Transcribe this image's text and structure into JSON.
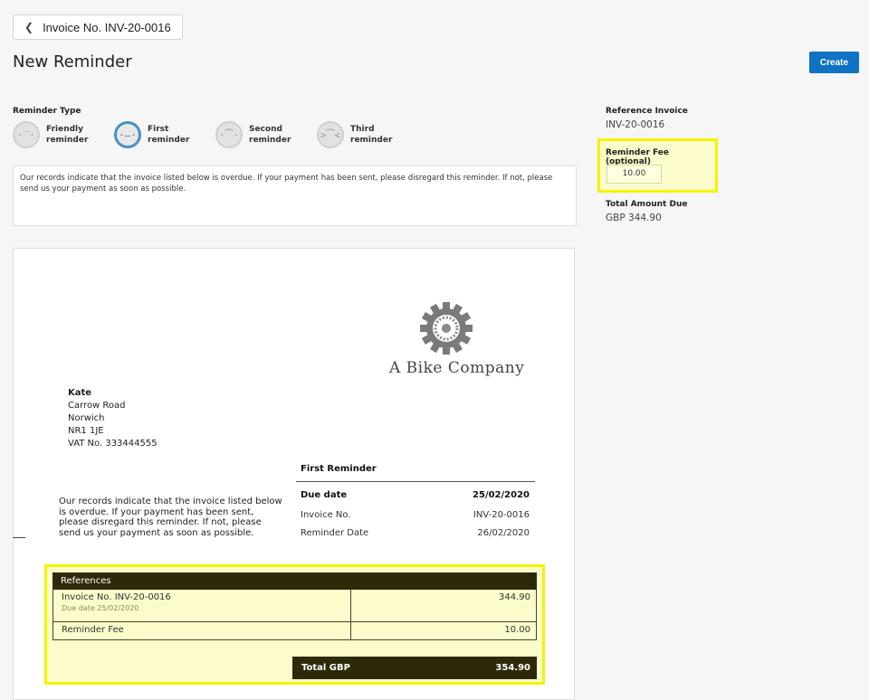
{
  "nav": {
    "back_label": "Invoice No. INV-20-0016"
  },
  "header": {
    "title": "New Reminder",
    "create_label": "Create"
  },
  "reminder_type": {
    "label": "Reminder Type",
    "options": [
      {
        "line1": "Friendly",
        "line2": "reminder",
        "icon": "neutral-face-icon",
        "selected": false
      },
      {
        "line1": "First",
        "line2": "reminder",
        "icon": "flat-face-icon",
        "selected": true
      },
      {
        "line1": "Second",
        "line2": "reminder",
        "icon": "sad-face-icon",
        "selected": false
      },
      {
        "line1": "Third",
        "line2": "reminder",
        "icon": "angry-face-icon",
        "selected": false
      }
    ]
  },
  "message": "Our records indicate that the invoice listed below is overdue. If your payment has been sent, please disregard this reminder. If not, please send us your payment as soon as possible.",
  "sidebar": {
    "reference_label": "Reference Invoice",
    "reference_value": "INV-20-0016",
    "fee_label": "Reminder Fee (optional)",
    "fee_value": "10.00",
    "total_label": "Total Amount Due",
    "total_value": "GBP 344.90"
  },
  "document": {
    "company": "A Bike Company",
    "address": {
      "name": "Kate",
      "street": "Carrow Road",
      "city": "Norwich",
      "postcode": "NR1 1JE",
      "vat": "VAT No. 333444555"
    },
    "letter": "Our records indicate that the invoice listed below is overdue. If your payment has been sent, please disregard this reminder. If not, please send us your payment as soon as possible.",
    "reminder_title": "First Reminder",
    "details": [
      {
        "label": "Due date",
        "value": "25/02/2020"
      },
      {
        "label": "Invoice No.",
        "value": "INV-20-0016"
      },
      {
        "label": "Reminder Date",
        "value": "26/02/2020"
      }
    ],
    "references": {
      "header": "References",
      "rows": [
        {
          "label": "Invoice No. INV-20-0016",
          "sub": "Due date 25/02/2020",
          "amount": "344.90"
        },
        {
          "label": "Reminder Fee",
          "sub": "",
          "amount": "10.00"
        }
      ],
      "total_label": "Total GBP",
      "total_value": "354.90"
    }
  },
  "colors": {
    "primary": "#0f72c3",
    "highlight": "#f4f400",
    "table_dark": "#2e2a09",
    "selected_ring": "#4a90c4"
  }
}
